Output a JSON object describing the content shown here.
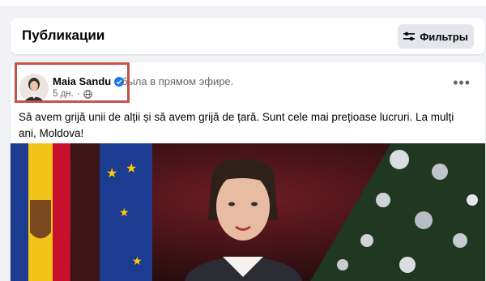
{
  "publications": {
    "title": "Публикации",
    "filter_label": "Фильтры"
  },
  "post": {
    "author": "Maia Sandu",
    "status": "была в прямом эфире.",
    "time": "5 дн.",
    "text": "Să avem grijă unii de alții și să avem grijă de țară. Sunt cele mai prețioase lucruri. La mulți ani, Moldova!"
  },
  "colors": {
    "highlight": "#c5524a",
    "verified": "#1877f2"
  }
}
